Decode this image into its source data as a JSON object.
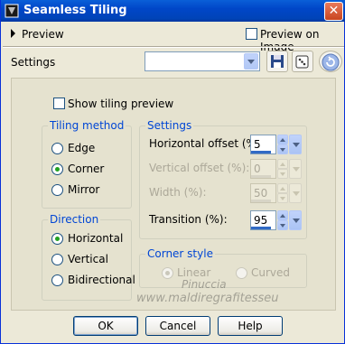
{
  "window": {
    "title": "Seamless Tiling",
    "close_symbol": "✕"
  },
  "preview": {
    "label": "Preview",
    "preview_on_image_label": "Preview on Image",
    "preview_on_image_checked": false
  },
  "settings_bar": {
    "label": "Settings",
    "preset_value": ""
  },
  "show_tiling_preview": {
    "label": "Show tiling preview",
    "checked": false
  },
  "tiling_method": {
    "title": "Tiling method",
    "options": [
      {
        "label": "Edge",
        "selected": false
      },
      {
        "label": "Corner",
        "selected": true
      },
      {
        "label": "Mirror",
        "selected": false
      }
    ]
  },
  "direction": {
    "title": "Direction",
    "options": [
      {
        "label": "Horizontal",
        "selected": true
      },
      {
        "label": "Vertical",
        "selected": false
      },
      {
        "label": "Bidirectional",
        "selected": false
      }
    ]
  },
  "settings_group": {
    "title": "Settings",
    "fields": [
      {
        "label": "Horizontal offset (%):",
        "value": "5",
        "enabled": true
      },
      {
        "label": "Vertical offset (%):",
        "value": "0",
        "enabled": false
      },
      {
        "label": "Width (%):",
        "value": "50",
        "enabled": false
      },
      {
        "label": "Transition (%):",
        "value": "95",
        "enabled": true
      }
    ]
  },
  "corner_style": {
    "title": "Corner style",
    "options": [
      {
        "label": "Linear",
        "selected": true,
        "enabled": false
      },
      {
        "label": "Curved",
        "selected": false,
        "enabled": false
      }
    ]
  },
  "watermark": {
    "line1": "Pinuccia",
    "line2": "www.maldiregrafitesseu"
  },
  "buttons": {
    "ok": "OK",
    "cancel": "Cancel",
    "help": "Help"
  },
  "colors": {
    "titlebar": "#0046c8",
    "group_title": "#0046d5",
    "dialog_bg": "#ece9d8"
  }
}
